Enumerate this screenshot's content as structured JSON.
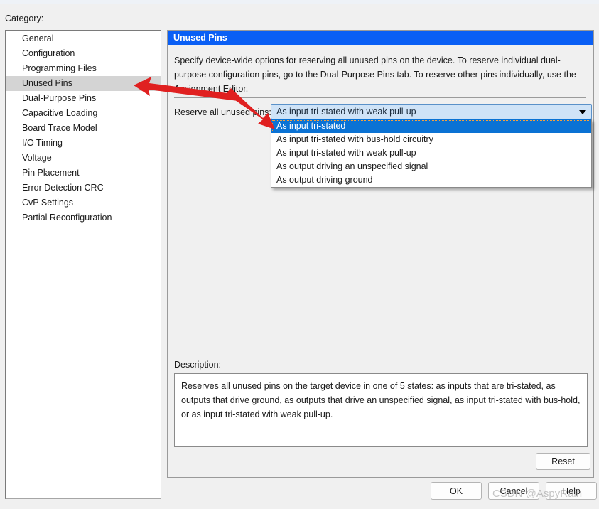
{
  "category": {
    "label": "Category:",
    "items": [
      "General",
      "Configuration",
      "Programming Files",
      "Unused Pins",
      "Dual-Purpose Pins",
      "Capacitive Loading",
      "Board Trace Model",
      "I/O Timing",
      "Voltage",
      "Pin Placement",
      "Error Detection CRC",
      "CvP Settings",
      "Partial Reconfiguration"
    ],
    "selected": "Unused Pins"
  },
  "panel": {
    "title": "Unused Pins",
    "description": "Specify device-wide options for reserving all unused pins on the device. To reserve individual dual-purpose configuration pins, go to the Dual-Purpose Pins tab. To reserve other pins individually, use the Assignment Editor.",
    "reserve_label": "Reserve all unused pins:",
    "combo_value": "As input tri-stated with weak pull-up",
    "dropdown_options": [
      "As input tri-stated",
      "As input tri-stated with bus-hold circuitry",
      "As input tri-stated with weak pull-up",
      "As output driving an unspecified signal",
      "As output driving ground"
    ],
    "dropdown_highlighted": "As input tri-stated",
    "description_label": "Description:",
    "description_text": "Reserves all unused pins on the target device in one of 5 states: as inputs that are tri-stated, as outputs that drive ground, as outputs that drive an unspecified signal, as input tri-stated with bus-hold, or as input tri-stated with weak pull-up.",
    "reset_label": "Reset"
  },
  "buttons": {
    "ok": "OK",
    "cancel": "Cancel",
    "help": "Help"
  },
  "watermark": "CSDN @AspyRain",
  "colors": {
    "title_bar": "#0a5ff5",
    "highlight": "#0a72d4",
    "selection_gray": "#d4d4d4",
    "arrow_red": "#e02020",
    "window_bg": "#f0f0f0"
  }
}
